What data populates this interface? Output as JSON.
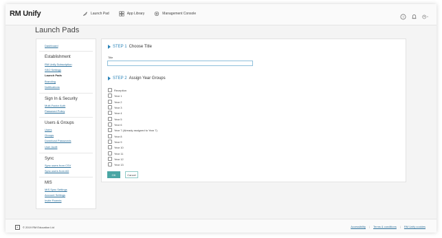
{
  "header": {
    "logo": "RM Unify",
    "nav": [
      {
        "label": "Launch Pad",
        "icon": "rocket-icon"
      },
      {
        "label": "App Library",
        "icon": "app-library-icon"
      },
      {
        "label": "Management Console",
        "icon": "settings-icon"
      }
    ],
    "right_icons": [
      "help-icon",
      "bell-icon",
      "user-menu-icon"
    ]
  },
  "page": {
    "title": "Launch Pads"
  },
  "sidebar": {
    "top_link": "Dashboard",
    "sections": [
      {
        "heading": "Establishment",
        "items": [
          "RM Unify Subscription",
          "SSO Settings",
          "Launch Pads",
          "Branding",
          "Notifications"
        ],
        "active": 2
      },
      {
        "heading": "Sign In & Security",
        "items": [
          "Multi-Factor Auth",
          "Password Policy"
        ]
      },
      {
        "heading": "Users & Groups",
        "items": [
          "Users",
          "Groups",
          "Download Passwords",
          "User Audit"
        ]
      },
      {
        "heading": "Sync",
        "items": [
          "Sync users from CSV",
          "Sync users from AD"
        ]
      },
      {
        "heading": "MIS",
        "items": [
          "MIS Sync Settings",
          "Account Settings",
          "Invite Parents"
        ]
      }
    ]
  },
  "form": {
    "step1": {
      "number": "STEP 1",
      "title": "Choose Title"
    },
    "title_label": "Title",
    "title_value": "",
    "step2": {
      "number": "STEP 2",
      "title": "Assign Year Groups"
    },
    "year_groups": [
      "Reception",
      "Year 1",
      "Year 2",
      "Year 3",
      "Year 4",
      "Year 5",
      "Year 6",
      "Year 7 (Already assigned to Year 7)",
      "Year 8",
      "Year 9",
      "Year 10",
      "Year 11",
      "Year 12",
      "Year 13"
    ],
    "ok_label": "OK",
    "cancel_label": "Cancel"
  },
  "footer": {
    "copyright": "© 2019 RM Education Ltd",
    "links": [
      "Accessibility",
      "Terms & conditions",
      "RM Unify cookies"
    ]
  },
  "colors": {
    "accent": "#2a83b8",
    "ok_button": "#4aa6a4",
    "link": "#2a6f9a"
  }
}
